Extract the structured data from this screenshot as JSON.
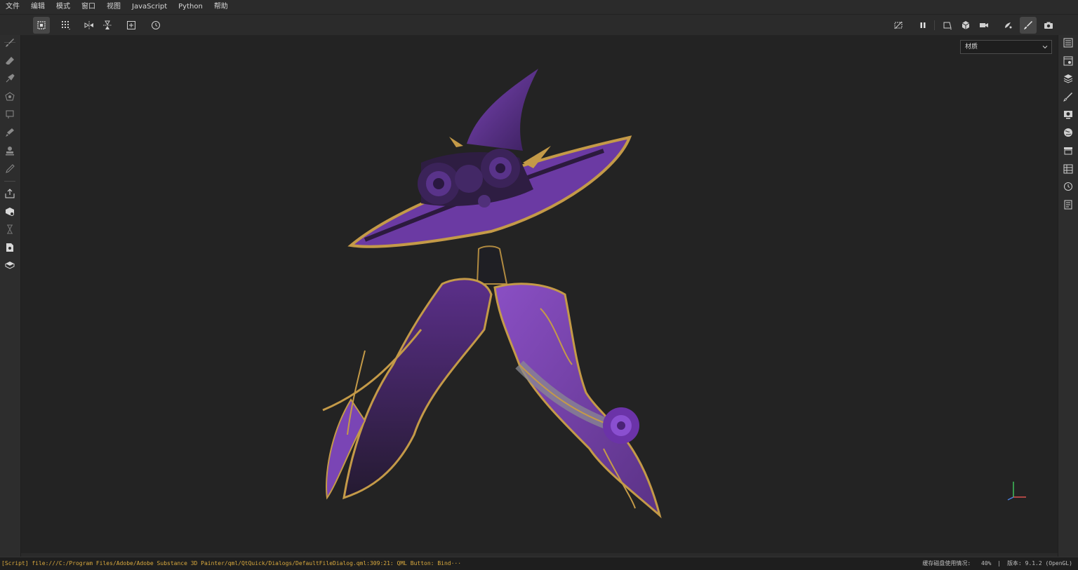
{
  "menu": [
    "文件",
    "编辑",
    "模式",
    "窗口",
    "视图",
    "JavaScript",
    "Python",
    "帮助"
  ],
  "viewport": {
    "mode_select_value": "材质",
    "model": {
      "hat_color": "#6a3a9e",
      "cape_color": "#3d2a5a",
      "trim_color": "#c49a48"
    }
  },
  "status": {
    "log": "[Script] file:///C:/Program Files/Adobe/Adobe Substance 3D Painter/qml/QtQuick/Dialogs/DefaultFileDialog.qml:309:21: QML Button: Bind···",
    "disk_label": "缓存磁盘使用情况:",
    "disk_value": "40%",
    "separator": "|",
    "version": "版本: 9.1.2 (OpenGL)"
  },
  "colors": {
    "bg": "#232323",
    "panel": "#2d2d2d",
    "accent_log": "#d9a93e"
  }
}
